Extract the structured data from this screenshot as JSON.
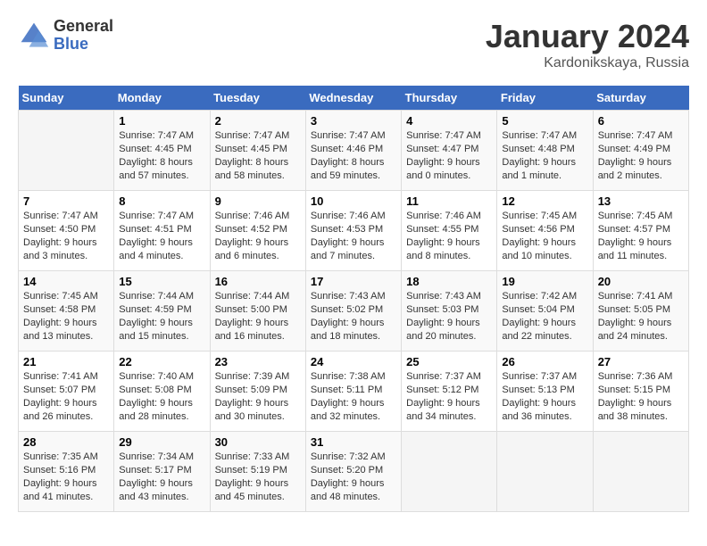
{
  "header": {
    "logo_general": "General",
    "logo_blue": "Blue",
    "title": "January 2024",
    "location": "Kardonikskaya, Russia"
  },
  "days_of_week": [
    "Sunday",
    "Monday",
    "Tuesday",
    "Wednesday",
    "Thursday",
    "Friday",
    "Saturday"
  ],
  "weeks": [
    [
      {
        "day": "",
        "info": ""
      },
      {
        "day": "1",
        "info": "Sunrise: 7:47 AM\nSunset: 4:45 PM\nDaylight: 8 hours\nand 57 minutes."
      },
      {
        "day": "2",
        "info": "Sunrise: 7:47 AM\nSunset: 4:45 PM\nDaylight: 8 hours\nand 58 minutes."
      },
      {
        "day": "3",
        "info": "Sunrise: 7:47 AM\nSunset: 4:46 PM\nDaylight: 8 hours\nand 59 minutes."
      },
      {
        "day": "4",
        "info": "Sunrise: 7:47 AM\nSunset: 4:47 PM\nDaylight: 9 hours\nand 0 minutes."
      },
      {
        "day": "5",
        "info": "Sunrise: 7:47 AM\nSunset: 4:48 PM\nDaylight: 9 hours\nand 1 minute."
      },
      {
        "day": "6",
        "info": "Sunrise: 7:47 AM\nSunset: 4:49 PM\nDaylight: 9 hours\nand 2 minutes."
      }
    ],
    [
      {
        "day": "7",
        "info": "Sunrise: 7:47 AM\nSunset: 4:50 PM\nDaylight: 9 hours\nand 3 minutes."
      },
      {
        "day": "8",
        "info": "Sunrise: 7:47 AM\nSunset: 4:51 PM\nDaylight: 9 hours\nand 4 minutes."
      },
      {
        "day": "9",
        "info": "Sunrise: 7:46 AM\nSunset: 4:52 PM\nDaylight: 9 hours\nand 6 minutes."
      },
      {
        "day": "10",
        "info": "Sunrise: 7:46 AM\nSunset: 4:53 PM\nDaylight: 9 hours\nand 7 minutes."
      },
      {
        "day": "11",
        "info": "Sunrise: 7:46 AM\nSunset: 4:55 PM\nDaylight: 9 hours\nand 8 minutes."
      },
      {
        "day": "12",
        "info": "Sunrise: 7:45 AM\nSunset: 4:56 PM\nDaylight: 9 hours\nand 10 minutes."
      },
      {
        "day": "13",
        "info": "Sunrise: 7:45 AM\nSunset: 4:57 PM\nDaylight: 9 hours\nand 11 minutes."
      }
    ],
    [
      {
        "day": "14",
        "info": "Sunrise: 7:45 AM\nSunset: 4:58 PM\nDaylight: 9 hours\nand 13 minutes."
      },
      {
        "day": "15",
        "info": "Sunrise: 7:44 AM\nSunset: 4:59 PM\nDaylight: 9 hours\nand 15 minutes."
      },
      {
        "day": "16",
        "info": "Sunrise: 7:44 AM\nSunset: 5:00 PM\nDaylight: 9 hours\nand 16 minutes."
      },
      {
        "day": "17",
        "info": "Sunrise: 7:43 AM\nSunset: 5:02 PM\nDaylight: 9 hours\nand 18 minutes."
      },
      {
        "day": "18",
        "info": "Sunrise: 7:43 AM\nSunset: 5:03 PM\nDaylight: 9 hours\nand 20 minutes."
      },
      {
        "day": "19",
        "info": "Sunrise: 7:42 AM\nSunset: 5:04 PM\nDaylight: 9 hours\nand 22 minutes."
      },
      {
        "day": "20",
        "info": "Sunrise: 7:41 AM\nSunset: 5:05 PM\nDaylight: 9 hours\nand 24 minutes."
      }
    ],
    [
      {
        "day": "21",
        "info": "Sunrise: 7:41 AM\nSunset: 5:07 PM\nDaylight: 9 hours\nand 26 minutes."
      },
      {
        "day": "22",
        "info": "Sunrise: 7:40 AM\nSunset: 5:08 PM\nDaylight: 9 hours\nand 28 minutes."
      },
      {
        "day": "23",
        "info": "Sunrise: 7:39 AM\nSunset: 5:09 PM\nDaylight: 9 hours\nand 30 minutes."
      },
      {
        "day": "24",
        "info": "Sunrise: 7:38 AM\nSunset: 5:11 PM\nDaylight: 9 hours\nand 32 minutes."
      },
      {
        "day": "25",
        "info": "Sunrise: 7:37 AM\nSunset: 5:12 PM\nDaylight: 9 hours\nand 34 minutes."
      },
      {
        "day": "26",
        "info": "Sunrise: 7:37 AM\nSunset: 5:13 PM\nDaylight: 9 hours\nand 36 minutes."
      },
      {
        "day": "27",
        "info": "Sunrise: 7:36 AM\nSunset: 5:15 PM\nDaylight: 9 hours\nand 38 minutes."
      }
    ],
    [
      {
        "day": "28",
        "info": "Sunrise: 7:35 AM\nSunset: 5:16 PM\nDaylight: 9 hours\nand 41 minutes."
      },
      {
        "day": "29",
        "info": "Sunrise: 7:34 AM\nSunset: 5:17 PM\nDaylight: 9 hours\nand 43 minutes."
      },
      {
        "day": "30",
        "info": "Sunrise: 7:33 AM\nSunset: 5:19 PM\nDaylight: 9 hours\nand 45 minutes."
      },
      {
        "day": "31",
        "info": "Sunrise: 7:32 AM\nSunset: 5:20 PM\nDaylight: 9 hours\nand 48 minutes."
      },
      {
        "day": "",
        "info": ""
      },
      {
        "day": "",
        "info": ""
      },
      {
        "day": "",
        "info": ""
      }
    ]
  ]
}
